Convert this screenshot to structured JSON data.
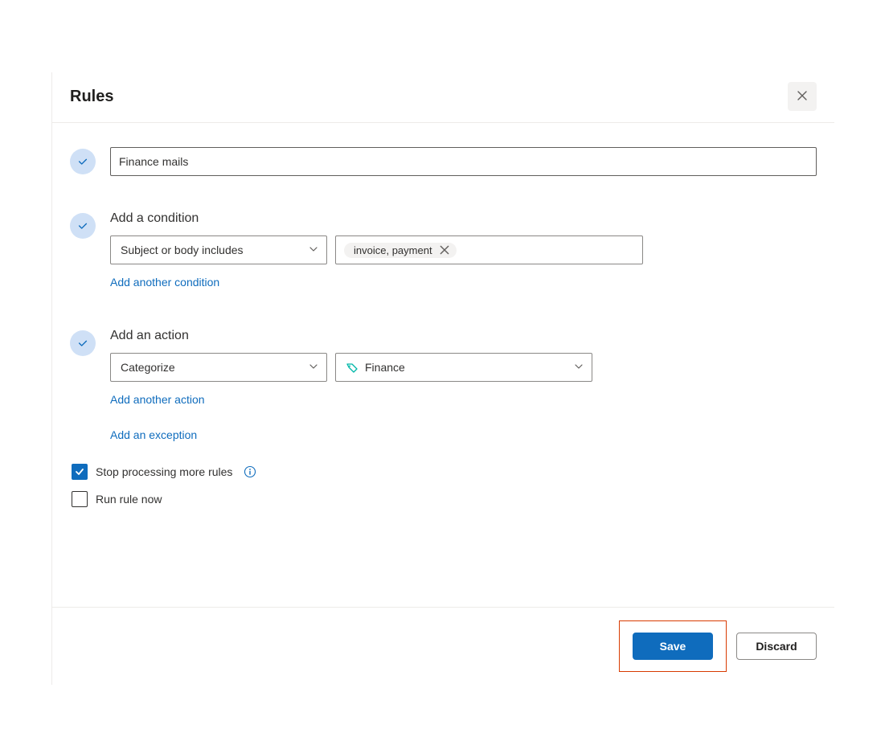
{
  "header": {
    "title": "Rules"
  },
  "rule": {
    "name_value": "Finance mails"
  },
  "condition": {
    "label": "Add a condition",
    "type": "Subject or body includes",
    "chip_text": "invoice, payment",
    "add_link": "Add another condition"
  },
  "action": {
    "label": "Add an action",
    "type": "Categorize",
    "value": "Finance",
    "add_link": "Add another action",
    "exception_link": "Add an exception"
  },
  "options": {
    "stop_processing": "Stop processing more rules",
    "run_now": "Run rule now"
  },
  "footer": {
    "save": "Save",
    "discard": "Discard"
  }
}
